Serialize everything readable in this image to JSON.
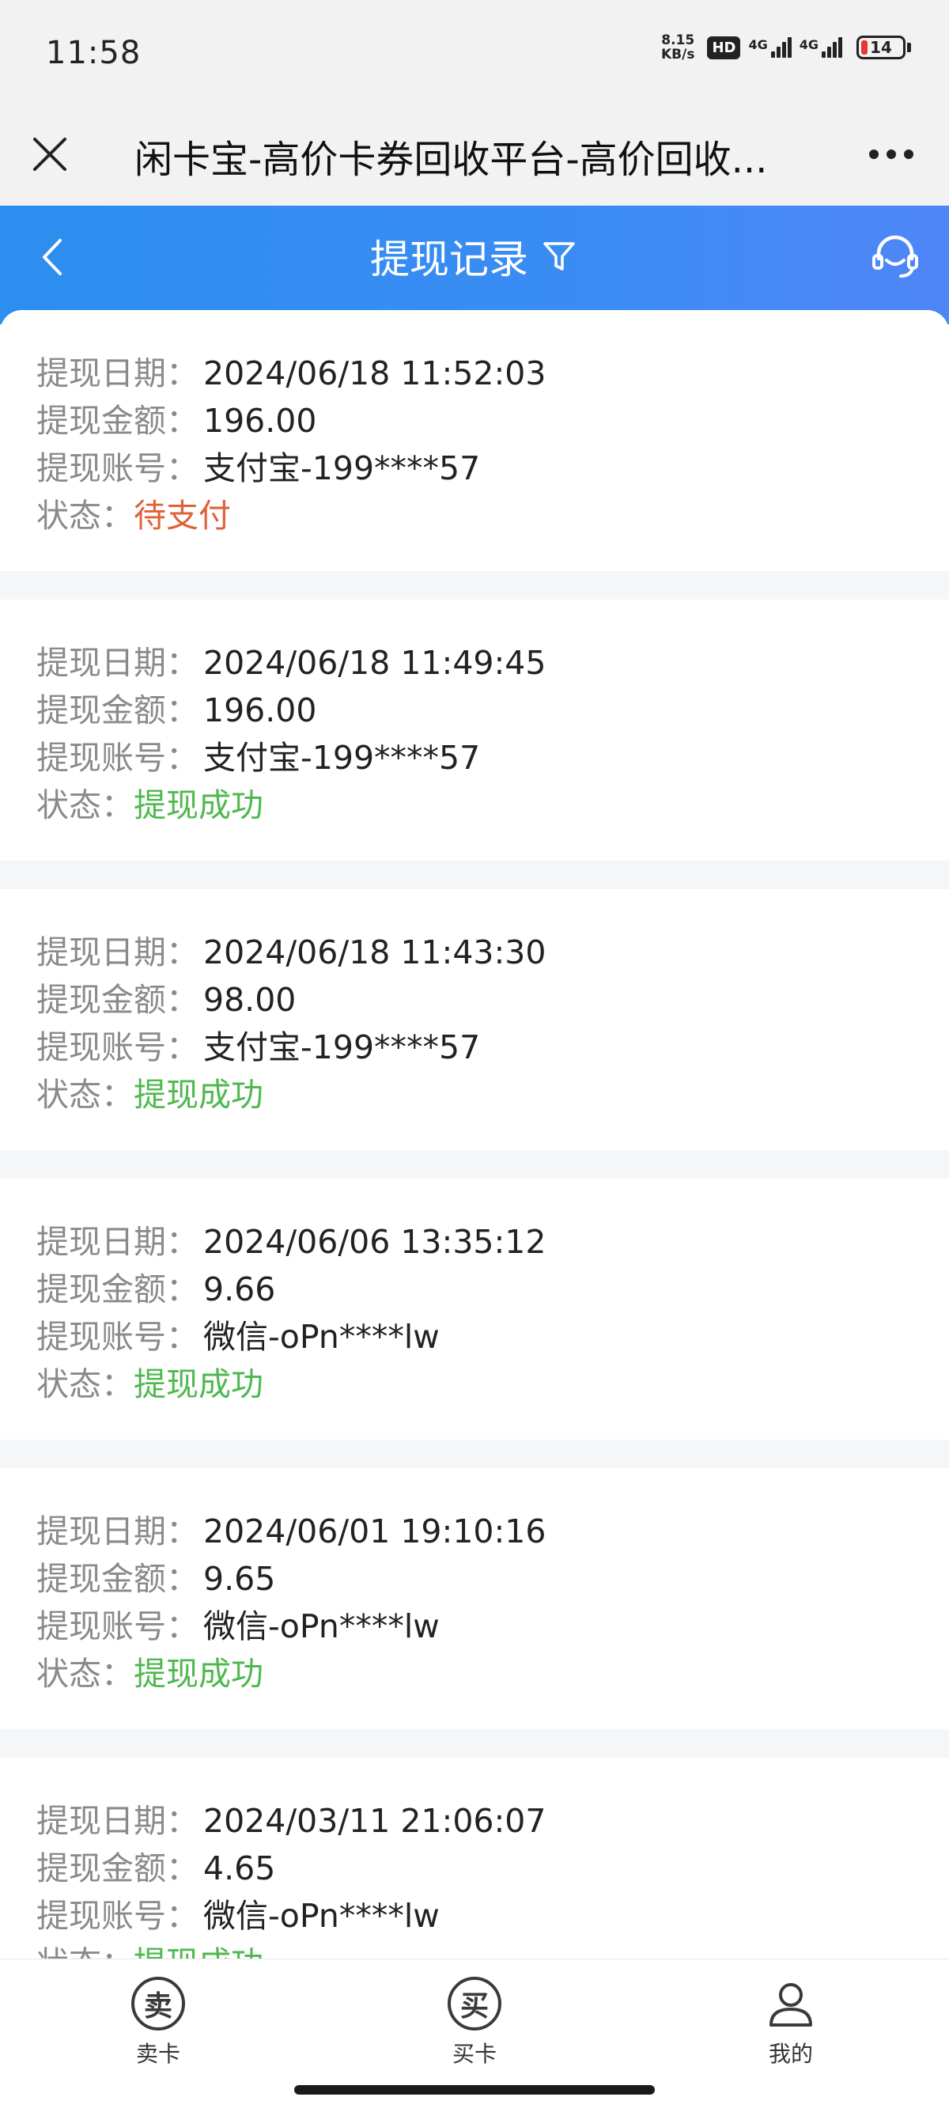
{
  "status_bar": {
    "time": "11:58",
    "speed_value": "8.15",
    "speed_unit": "KB/s",
    "hd_label": "HD",
    "network1": "4G",
    "network2": "4G",
    "battery": "14"
  },
  "browser": {
    "title": "闲卡宝-高价卡券回收平台-高价回收..."
  },
  "header": {
    "title": "提现记录"
  },
  "labels": {
    "date": "提现日期：",
    "amount": "提现金额：",
    "account": "提现账号：",
    "status": "状态："
  },
  "records": [
    {
      "date": "2024/06/18 11:52:03",
      "amount": "196.00",
      "account": "支付宝-199****57",
      "status": "待支付"
    },
    {
      "date": "2024/06/18 11:49:45",
      "amount": "196.00",
      "account": "支付宝-199****57",
      "status": "提现成功"
    },
    {
      "date": "2024/06/18 11:43:30",
      "amount": "98.00",
      "account": "支付宝-199****57",
      "status": "提现成功"
    },
    {
      "date": "2024/06/06 13:35:12",
      "amount": "9.66",
      "account": "微信-oPn****lw",
      "status": "提现成功"
    },
    {
      "date": "2024/06/01 19:10:16",
      "amount": "9.65",
      "account": "微信-oPn****lw",
      "status": "提现成功"
    },
    {
      "date": "2024/03/11 21:06:07",
      "amount": "4.65",
      "account": "微信-oPn****lw",
      "status": "提现成功"
    }
  ],
  "tabbar": {
    "sell_icon": "卖",
    "sell_label": "卖卡",
    "buy_icon": "买",
    "buy_label": "买卡",
    "mine_label": "我的"
  },
  "colors": {
    "header_blue": "#3a8cf3",
    "pending": "#e0603a",
    "success": "#4fb84f"
  }
}
